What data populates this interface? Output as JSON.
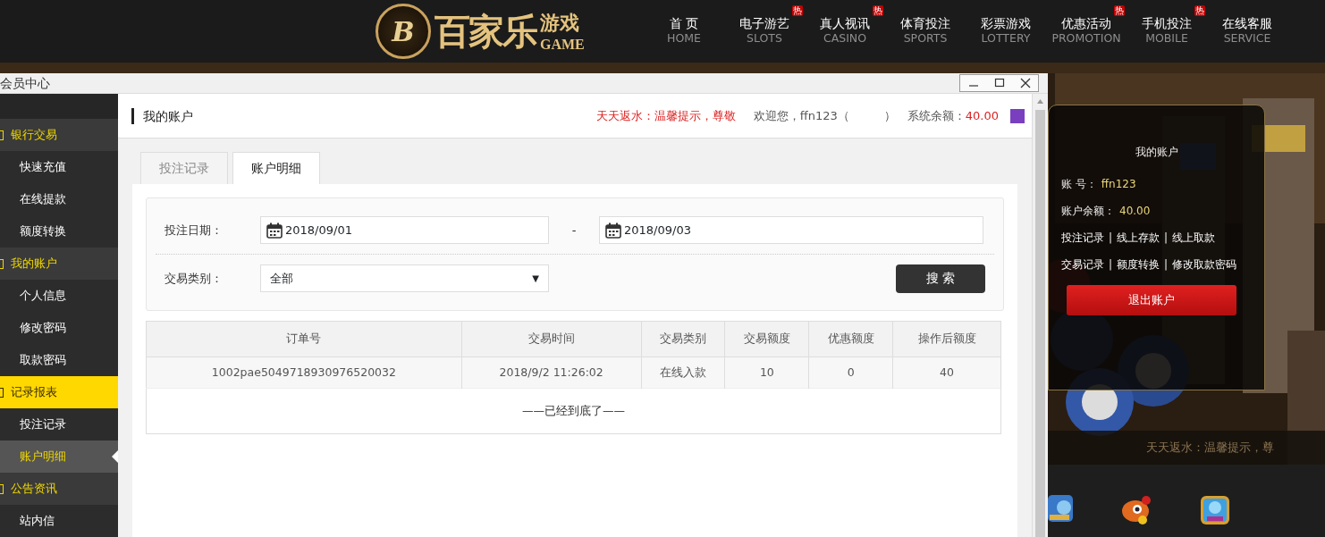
{
  "header": {
    "logo": {
      "emblem": "B",
      "title": "百家乐",
      "subtitle": "游戏",
      "subtitle_en": "GAME"
    },
    "nav": [
      {
        "label": "首 页",
        "label_en": "HOME"
      },
      {
        "label": "电子游艺",
        "label_en": "SLOTS",
        "badge": "热"
      },
      {
        "label": "真人视讯",
        "label_en": "CASINO",
        "badge": "热"
      },
      {
        "label": "体育投注",
        "label_en": "SPORTS"
      },
      {
        "label": "彩票游戏",
        "label_en": "LOTTERY"
      },
      {
        "label": "优惠活动",
        "label_en": "PROMOTION",
        "badge": "热"
      },
      {
        "label": "手机投注",
        "label_en": "MOBILE",
        "badge": "热"
      },
      {
        "label": "在线客服",
        "label_en": "SERVICE"
      }
    ]
  },
  "window": {
    "title": "会员中心"
  },
  "sidebar": [
    {
      "label": "银行交易",
      "selected": false,
      "children": [
        {
          "label": "快速充值",
          "selected": false
        },
        {
          "label": "在线提款",
          "selected": false
        },
        {
          "label": "额度转换",
          "selected": false
        }
      ]
    },
    {
      "label": "我的账户",
      "selected": false,
      "children": [
        {
          "label": "个人信息",
          "selected": false
        },
        {
          "label": "修改密码",
          "selected": false
        },
        {
          "label": "取款密码",
          "selected": false
        }
      ]
    },
    {
      "label": "记录报表",
      "selected": true,
      "children": [
        {
          "label": "投注记录",
          "selected": false
        },
        {
          "label": "账户明细",
          "selected": true
        }
      ]
    },
    {
      "label": "公告资讯",
      "selected": false,
      "children": [
        {
          "label": "站内信",
          "selected": false
        }
      ]
    }
  ],
  "account_header": {
    "title": "我的账户",
    "notice": "天天返水：温馨提示，尊敬",
    "welcome": "欢迎您，ffn123（",
    "welcome_end": "）",
    "balance_label": "系统余额：",
    "balance": "40.00"
  },
  "tabs": [
    {
      "label": "投注记录",
      "selected": false
    },
    {
      "label": "账户明细",
      "selected": true
    }
  ],
  "filters": {
    "date_label": "投注日期：",
    "date_from": "2018/09/01",
    "separator": "-",
    "date_to": "2018/09/03",
    "type_label": "交易类别：",
    "type_value": "全部",
    "type_caret": "▼",
    "search_button": "搜 索"
  },
  "table": {
    "columns": [
      "订单号",
      "交易时间",
      "交易类别",
      "交易额度",
      "优惠额度",
      "操作后额度"
    ],
    "rows": [
      [
        "1002pae5049718930976520032",
        "2018/9/2 11:26:02",
        "在线入款",
        "10",
        "0",
        "40"
      ]
    ],
    "end_note": "——已经到底了——"
  },
  "side_panel": {
    "title": "我的账户",
    "account_label": "账 号：",
    "account": "ffn123",
    "balance_label": "账户余额：",
    "balance": "40.00",
    "link_separator": "|",
    "link_rows": [
      [
        "投注记录",
        "线上存款",
        "线上取款"
      ],
      [
        "交易记录",
        "额度转换",
        "修改取款密码"
      ]
    ],
    "logout_button": "退出账户"
  },
  "marquee": "天天返水：温馨提示，尊"
}
